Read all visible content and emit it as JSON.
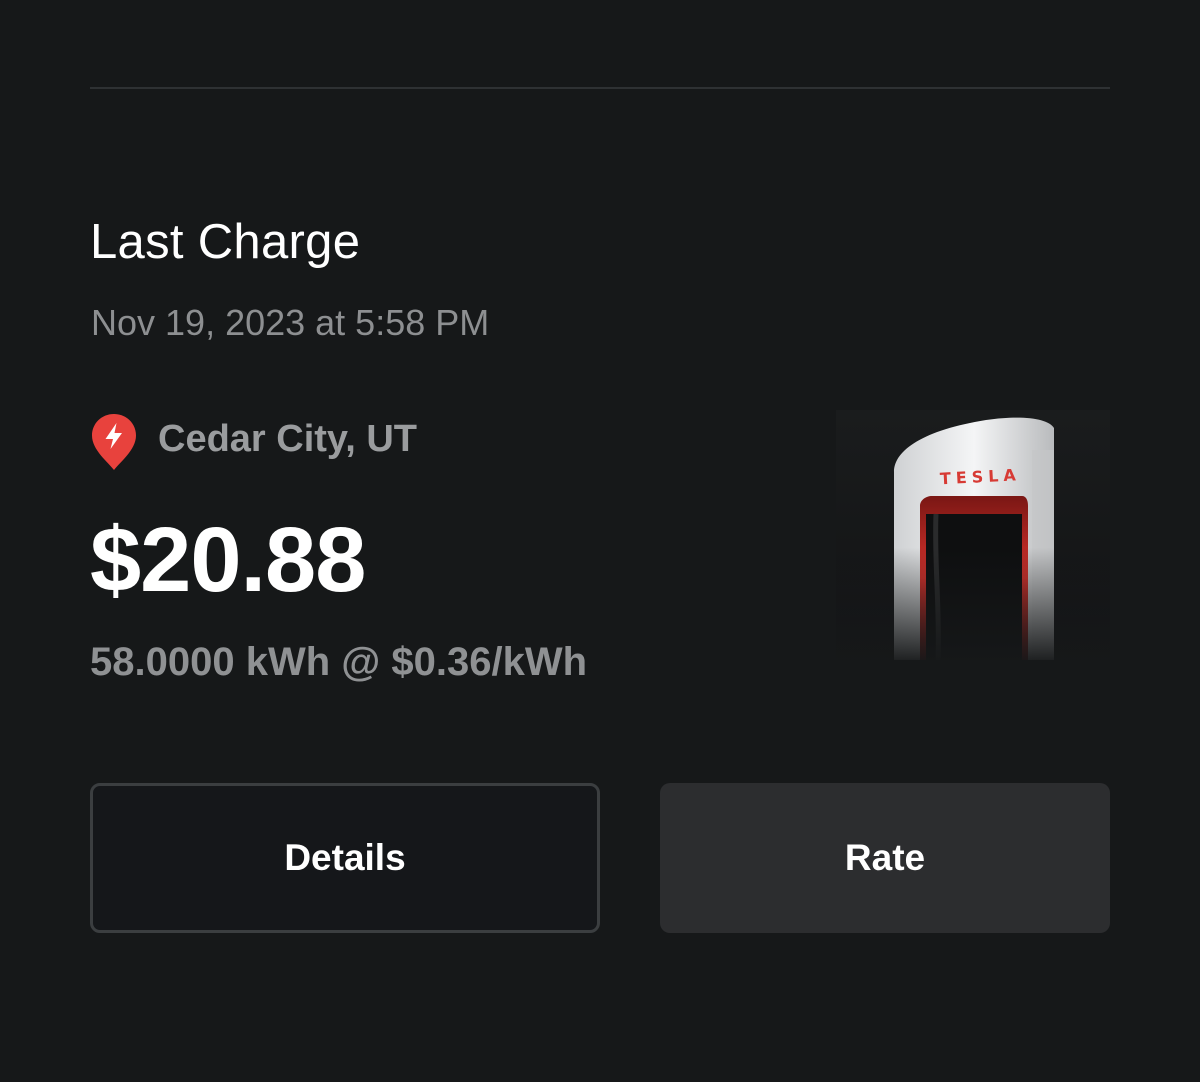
{
  "card": {
    "title": "Last Charge",
    "datetime": "Nov 19, 2023 at 5:58 PM",
    "location": {
      "icon": "supercharger-pin-icon",
      "name": "Cedar City, UT"
    },
    "price": "$20.88",
    "energy": "58.0000 kWh @ $0.36/kWh",
    "charger_image": {
      "icon": "tesla-supercharger-image",
      "brand_text": "TESLA"
    }
  },
  "actions": {
    "details_label": "Details",
    "rate_label": "Rate"
  },
  "colors": {
    "background": "#161819",
    "accent_red": "#e8423d",
    "text_primary": "#ffffff",
    "text_secondary": "#8d8f91",
    "button_secondary_bg": "#2c2d2f"
  }
}
